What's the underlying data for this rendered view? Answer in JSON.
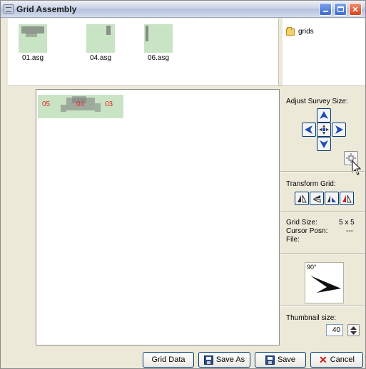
{
  "window": {
    "title": "Grid Assembly",
    "minimize_icon": "minimize-icon",
    "maximize_icon": "maximize-icon",
    "close_icon": "close-icon"
  },
  "thumbnails": [
    {
      "label": "01.asg"
    },
    {
      "label": "04.asg"
    },
    {
      "label": "06.asg"
    }
  ],
  "folder": {
    "name": "grids",
    "icon": "folder-icon"
  },
  "grid": {
    "cells": [
      {
        "number": "05"
      },
      {
        "number": "04"
      },
      {
        "number": "03"
      }
    ]
  },
  "right_panel": {
    "adjust_label": "Adjust Survey Size:",
    "transform_label": "Transform Grid:",
    "grid_size_label": "Grid Size:",
    "grid_size_value": "5 x 5",
    "cursor_label": "Cursor Posn:",
    "cursor_value": "---",
    "file_label": "File:",
    "preview_angle": "90°",
    "thumbnail_label": "Thumbnail size:",
    "thumbnail_value": "40"
  },
  "buttons": {
    "grid_data": "Grid Data",
    "save_as": "Save As",
    "save": "Save",
    "cancel": "Cancel"
  }
}
